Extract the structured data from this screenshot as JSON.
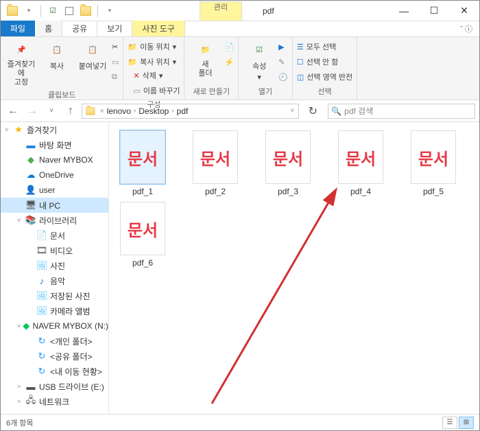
{
  "window": {
    "title": "pdf",
    "context_tab": "관리",
    "context_sub": "사진 도구"
  },
  "tabs": {
    "file": "파일",
    "home": "홈",
    "share": "공유",
    "view": "보기",
    "photo": "사진 도구"
  },
  "ribbon": {
    "clipboard": {
      "label": "클립보드",
      "pin": "즐겨찾기에\n고정",
      "copy": "복사",
      "paste": "붙여넣기",
      "cut": "✂"
    },
    "organize": {
      "label": "구성",
      "move_to": "이동 위치",
      "copy_to": "복사 위치",
      "delete": "삭제",
      "rename": "이름 바꾸기"
    },
    "new": {
      "label": "새로 만들기",
      "new_folder": "새\n폴더"
    },
    "open": {
      "label": "열기",
      "properties": "속성"
    },
    "select": {
      "label": "선택",
      "select_all": "모두 선택",
      "select_none": "선택 안 함",
      "invert": "선택 영역 반전"
    }
  },
  "nav": {
    "path": [
      "lenovo",
      "Desktop",
      "pdf"
    ],
    "search_placeholder": "pdf 검색"
  },
  "sidebar": {
    "items": [
      {
        "label": "즐겨찾기",
        "icon": "★",
        "color": "#f7b500",
        "chev": "˅"
      },
      {
        "label": "바탕 화면",
        "icon": "▬",
        "color": "#1e88e5",
        "indent": 1
      },
      {
        "label": "Naver MYBOX",
        "icon": "◆",
        "color": "#4caf50",
        "indent": 1
      },
      {
        "label": "OneDrive",
        "icon": "☁",
        "color": "#0078d4",
        "indent": 1
      },
      {
        "label": "user",
        "icon": "👤",
        "color": "#999",
        "indent": 1
      },
      {
        "label": "내 PC",
        "icon": "🖥",
        "color": "#555",
        "indent": 1,
        "selected": true
      },
      {
        "label": "라이브러리",
        "icon": "📚",
        "color": "#888",
        "indent": 1,
        "chev": "˅"
      },
      {
        "label": "문서",
        "icon": "📄",
        "color": "#d4a24e",
        "indent": 2
      },
      {
        "label": "비디오",
        "icon": "🎞",
        "color": "#555",
        "indent": 2
      },
      {
        "label": "사진",
        "icon": "🖼",
        "color": "#4fc3f7",
        "indent": 2
      },
      {
        "label": "음악",
        "icon": "♪",
        "color": "#1976d2",
        "indent": 2
      },
      {
        "label": "저장된 사진",
        "icon": "🖼",
        "color": "#4fc3f7",
        "indent": 2
      },
      {
        "label": "카메라 앨범",
        "icon": "🖼",
        "color": "#4fc3f7",
        "indent": 2
      },
      {
        "label": "NAVER MYBOX (N:)",
        "icon": "◆",
        "color": "#03c75a",
        "indent": 1,
        "chev": "˅"
      },
      {
        "label": "<개인 폴더>",
        "icon": "↻",
        "color": "#2196f3",
        "indent": 2
      },
      {
        "label": "<공유 폴더>",
        "icon": "↻",
        "color": "#2196f3",
        "indent": 2
      },
      {
        "label": "<내 이동 현황>",
        "icon": "↻",
        "color": "#2196f3",
        "indent": 2
      },
      {
        "label": "USB 드라이브 (E:)",
        "icon": "▬",
        "color": "#555",
        "indent": 1,
        "chev": ">"
      },
      {
        "label": "네트워크",
        "icon": "🖧",
        "color": "#555",
        "indent": 1,
        "chev": ">"
      }
    ]
  },
  "files": [
    {
      "name": "pdf_1",
      "thumb": "문서",
      "selected": true
    },
    {
      "name": "pdf_2",
      "thumb": "문서"
    },
    {
      "name": "pdf_3",
      "thumb": "문서"
    },
    {
      "name": "pdf_4",
      "thumb": "문서"
    },
    {
      "name": "pdf_5",
      "thumb": "문서"
    },
    {
      "name": "pdf_6",
      "thumb": "문서"
    }
  ],
  "status": {
    "count": "6개 항목"
  }
}
